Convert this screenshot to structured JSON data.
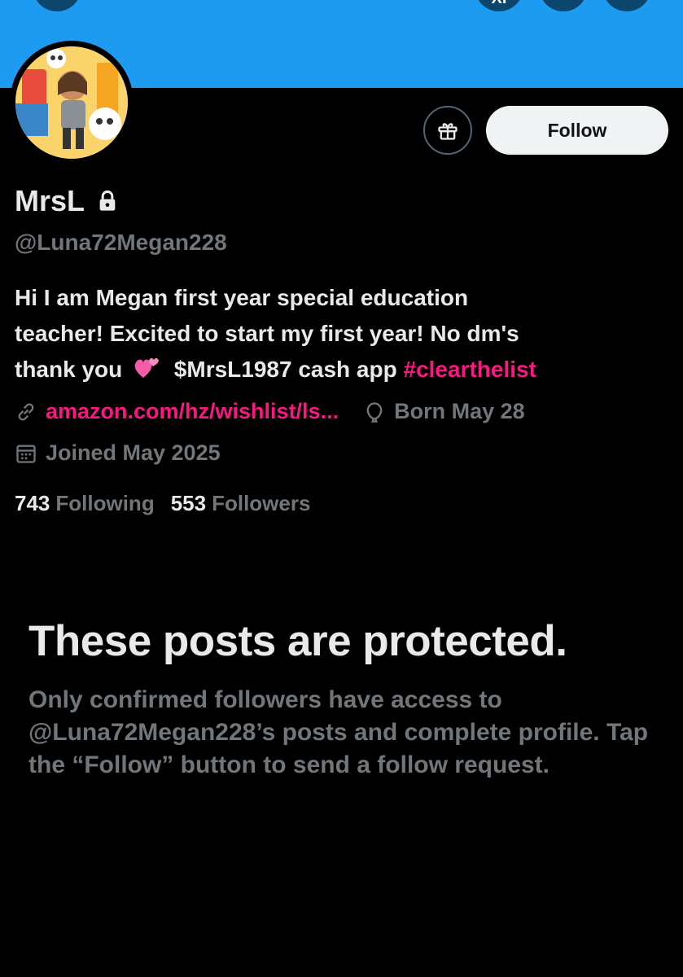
{
  "banner": {
    "top_right_button_text": "XI"
  },
  "profile": {
    "name": "MrsL",
    "handle": "@Luna72Megan228",
    "bio_line1": "Hi I am Megan first year special education",
    "bio_line2": "teacher! Excited to start my first year! No dm's",
    "bio_line3_prefix": "thank you",
    "bio_line3_cash": "$MrsL1987 cash app",
    "bio_hashtag": "#clearthelist",
    "link": "amazon.com/hz/wishlist/ls...",
    "birthday": "Born May 28",
    "joined": "Joined May 2025",
    "following_count": "743",
    "following_label": "Following",
    "followers_count": "553",
    "followers_label": "Followers"
  },
  "actions": {
    "follow_label": "Follow"
  },
  "protected": {
    "title": "These posts are protected.",
    "body": "Only confirmed followers have access to @Luna72Megan228’s posts and complete profile. Tap the “Follow” button to send a follow request."
  },
  "colors": {
    "accent": "#1d9bf0",
    "link": "#f91880",
    "muted": "#71767b",
    "text": "#e7e9ea"
  },
  "icons": [
    "back-icon",
    "gift-icon",
    "lock-icon",
    "link-icon",
    "balloon-icon",
    "calendar-icon",
    "sparkling-heart-emoji"
  ]
}
